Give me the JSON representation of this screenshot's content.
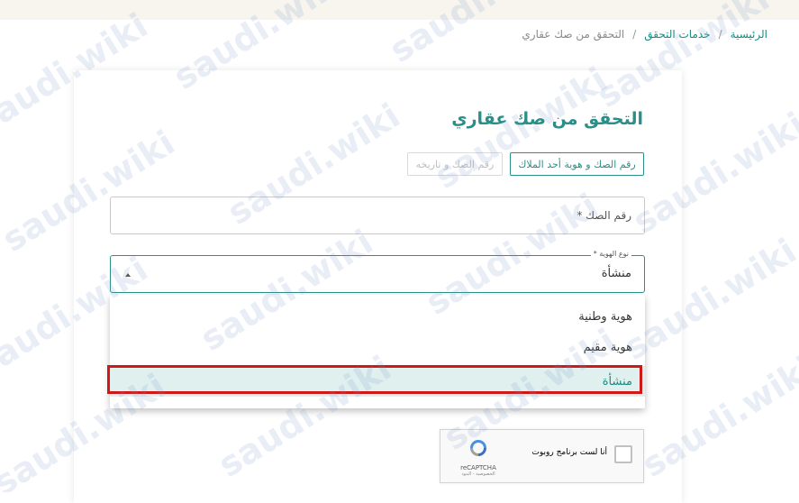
{
  "breadcrumb": {
    "home": "الرئيسية",
    "services": "خدمات التحقق",
    "current": "التحقق من صك عقاري",
    "separator": "/"
  },
  "page": {
    "title": "التحقق من صك عقاري"
  },
  "tabs": [
    {
      "label": "رقم الصك و هوية أحد الملاك",
      "active": true
    },
    {
      "label": "رقم الصك و تاريخه",
      "active": false
    }
  ],
  "form": {
    "deed_number": {
      "label": "رقم الصك *",
      "value": ""
    },
    "id_type": {
      "label": "نوع الهوية *",
      "value": "منشأة",
      "options": [
        "هوية وطنية",
        "هوية مقيم",
        "منشأة"
      ],
      "highlighted_option": "منشأة"
    }
  },
  "captcha": {
    "text": "أنا لست برنامج روبوت",
    "brand": "reCAPTCHA",
    "terms": "الخصوصية - البنود"
  },
  "watermark": "saudi.wiki",
  "colors": {
    "accent": "#2a8f88",
    "highlight_border": "#d01818",
    "selected_option_bg": "#dff0ef"
  }
}
